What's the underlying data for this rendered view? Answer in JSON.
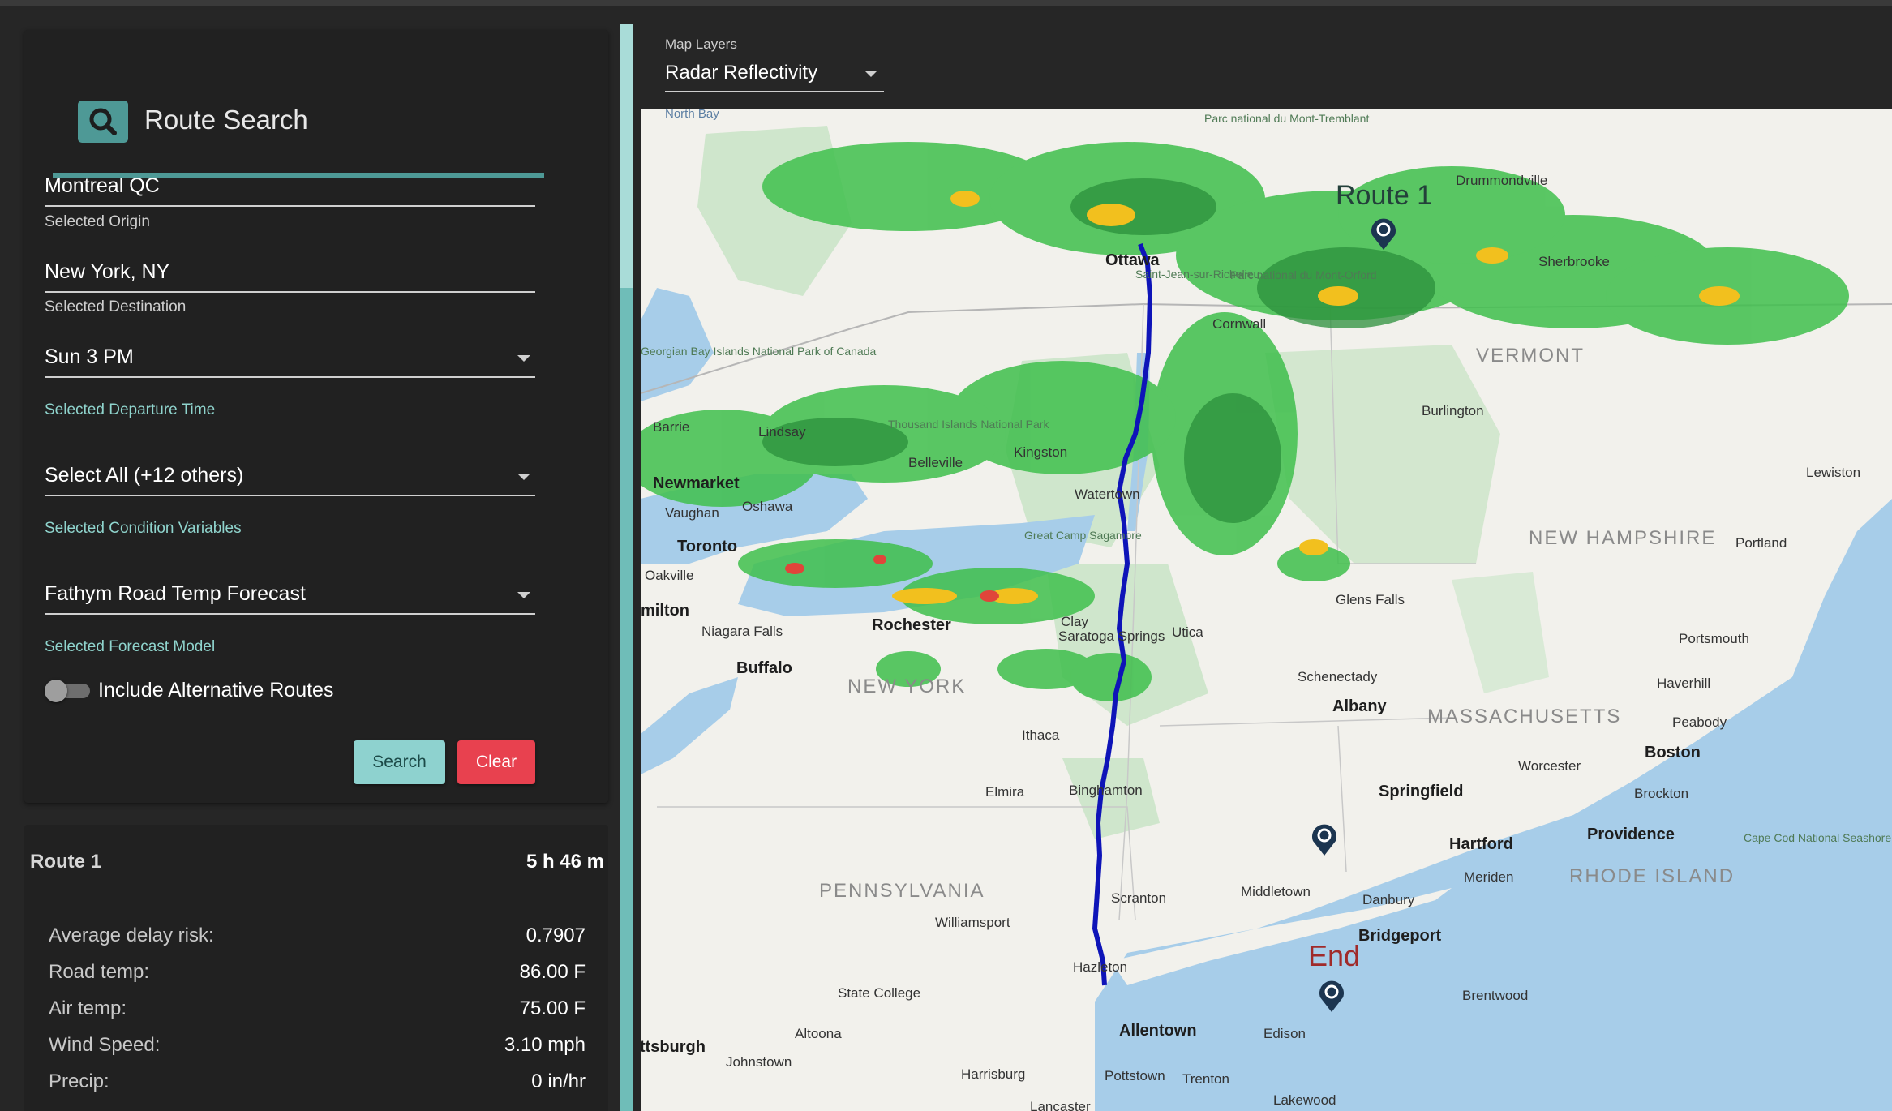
{
  "search": {
    "title": "Route Search",
    "origin": {
      "value": "Montreal QC",
      "helper": "Selected Origin"
    },
    "destination": {
      "value": "New York, NY",
      "helper": "Selected Destination"
    },
    "departure": {
      "value": "Sun 3 PM",
      "helper": "Selected Departure Time"
    },
    "conditions": {
      "value": "Select All (+12 others)",
      "helper": "Selected Condition Variables"
    },
    "model": {
      "value": "Fathym Road Temp Forecast",
      "helper": "Selected Forecast Model"
    },
    "alt_routes": {
      "label": "Include Alternative Routes",
      "enabled": false
    },
    "search_label": "Search",
    "clear_label": "Clear"
  },
  "route": {
    "name": "Route 1",
    "duration": "5 h 46 m",
    "stats": [
      {
        "label": "Average delay risk:",
        "value": "0.7907"
      },
      {
        "label": "Road temp:",
        "value": "86.00 F"
      },
      {
        "label": "Air temp:",
        "value": "75.00 F"
      },
      {
        "label": "Wind Speed:",
        "value": "3.10 mph"
      },
      {
        "label": "Precip:",
        "value": "0 in/hr"
      }
    ]
  },
  "map": {
    "layers_label": "Map Layers",
    "layer": "Radar Reflectivity",
    "route_label": "Route 1",
    "end_label": "End",
    "cities": [
      "Ottawa",
      "Cornwall",
      "Drummondville",
      "Sherbrooke",
      "Burlington",
      "Barrie",
      "Lindsay",
      "Belleville",
      "Kingston",
      "Watertown",
      "Newmarket",
      "Toronto",
      "Oshawa",
      "Vaughan",
      "Oakville",
      "milton",
      "Niagara Falls",
      "Buffalo",
      "Rochester",
      "Clay",
      "Utica",
      "Saratoga Springs",
      "Glens Falls",
      "Schenectady",
      "Albany",
      "Ithaca",
      "Elmira",
      "Binghamton",
      "Scranton",
      "Middletown",
      "Danbury",
      "Williamsport",
      "Hazleton",
      "State College",
      "Altoona",
      "Johnstown",
      "Harrisburg",
      "Pottstown",
      "Allentown",
      "Edison",
      "Trenton",
      "Lakewood",
      "Lancaster",
      "Springfield",
      "Hartford",
      "Meriden",
      "Bridgeport",
      "Brentwood",
      "Worcester",
      "Boston",
      "Brockton",
      "Providence",
      "Peabody",
      "Haverhill",
      "Portsmouth",
      "Portland",
      "Lewiston",
      "Saint-Jean-sur-Richelieu",
      "Parc national du Mont-Orford",
      "Parc national du Mont-Tremblant",
      "Georgian Bay Islands National Park of Canada",
      "Thousand Islands National Park",
      "Great Camp Sagamore",
      "Cape Cod National Seashore",
      "North Bay",
      "Pittsburgh"
    ],
    "states": [
      "NEW YORK",
      "PENNSYLVANIA",
      "MASSACHUSETTS",
      "NEW HAMPSHIRE",
      "RHODE ISLAND",
      "VERMONT"
    ],
    "colors": {
      "water": "#a7cde9",
      "land": "#f2f1ec",
      "park": "#cfe6cc",
      "route": "#0e14b8",
      "radar_light": "#3fbf4c",
      "radar_heavy": "#f2c01e"
    }
  }
}
